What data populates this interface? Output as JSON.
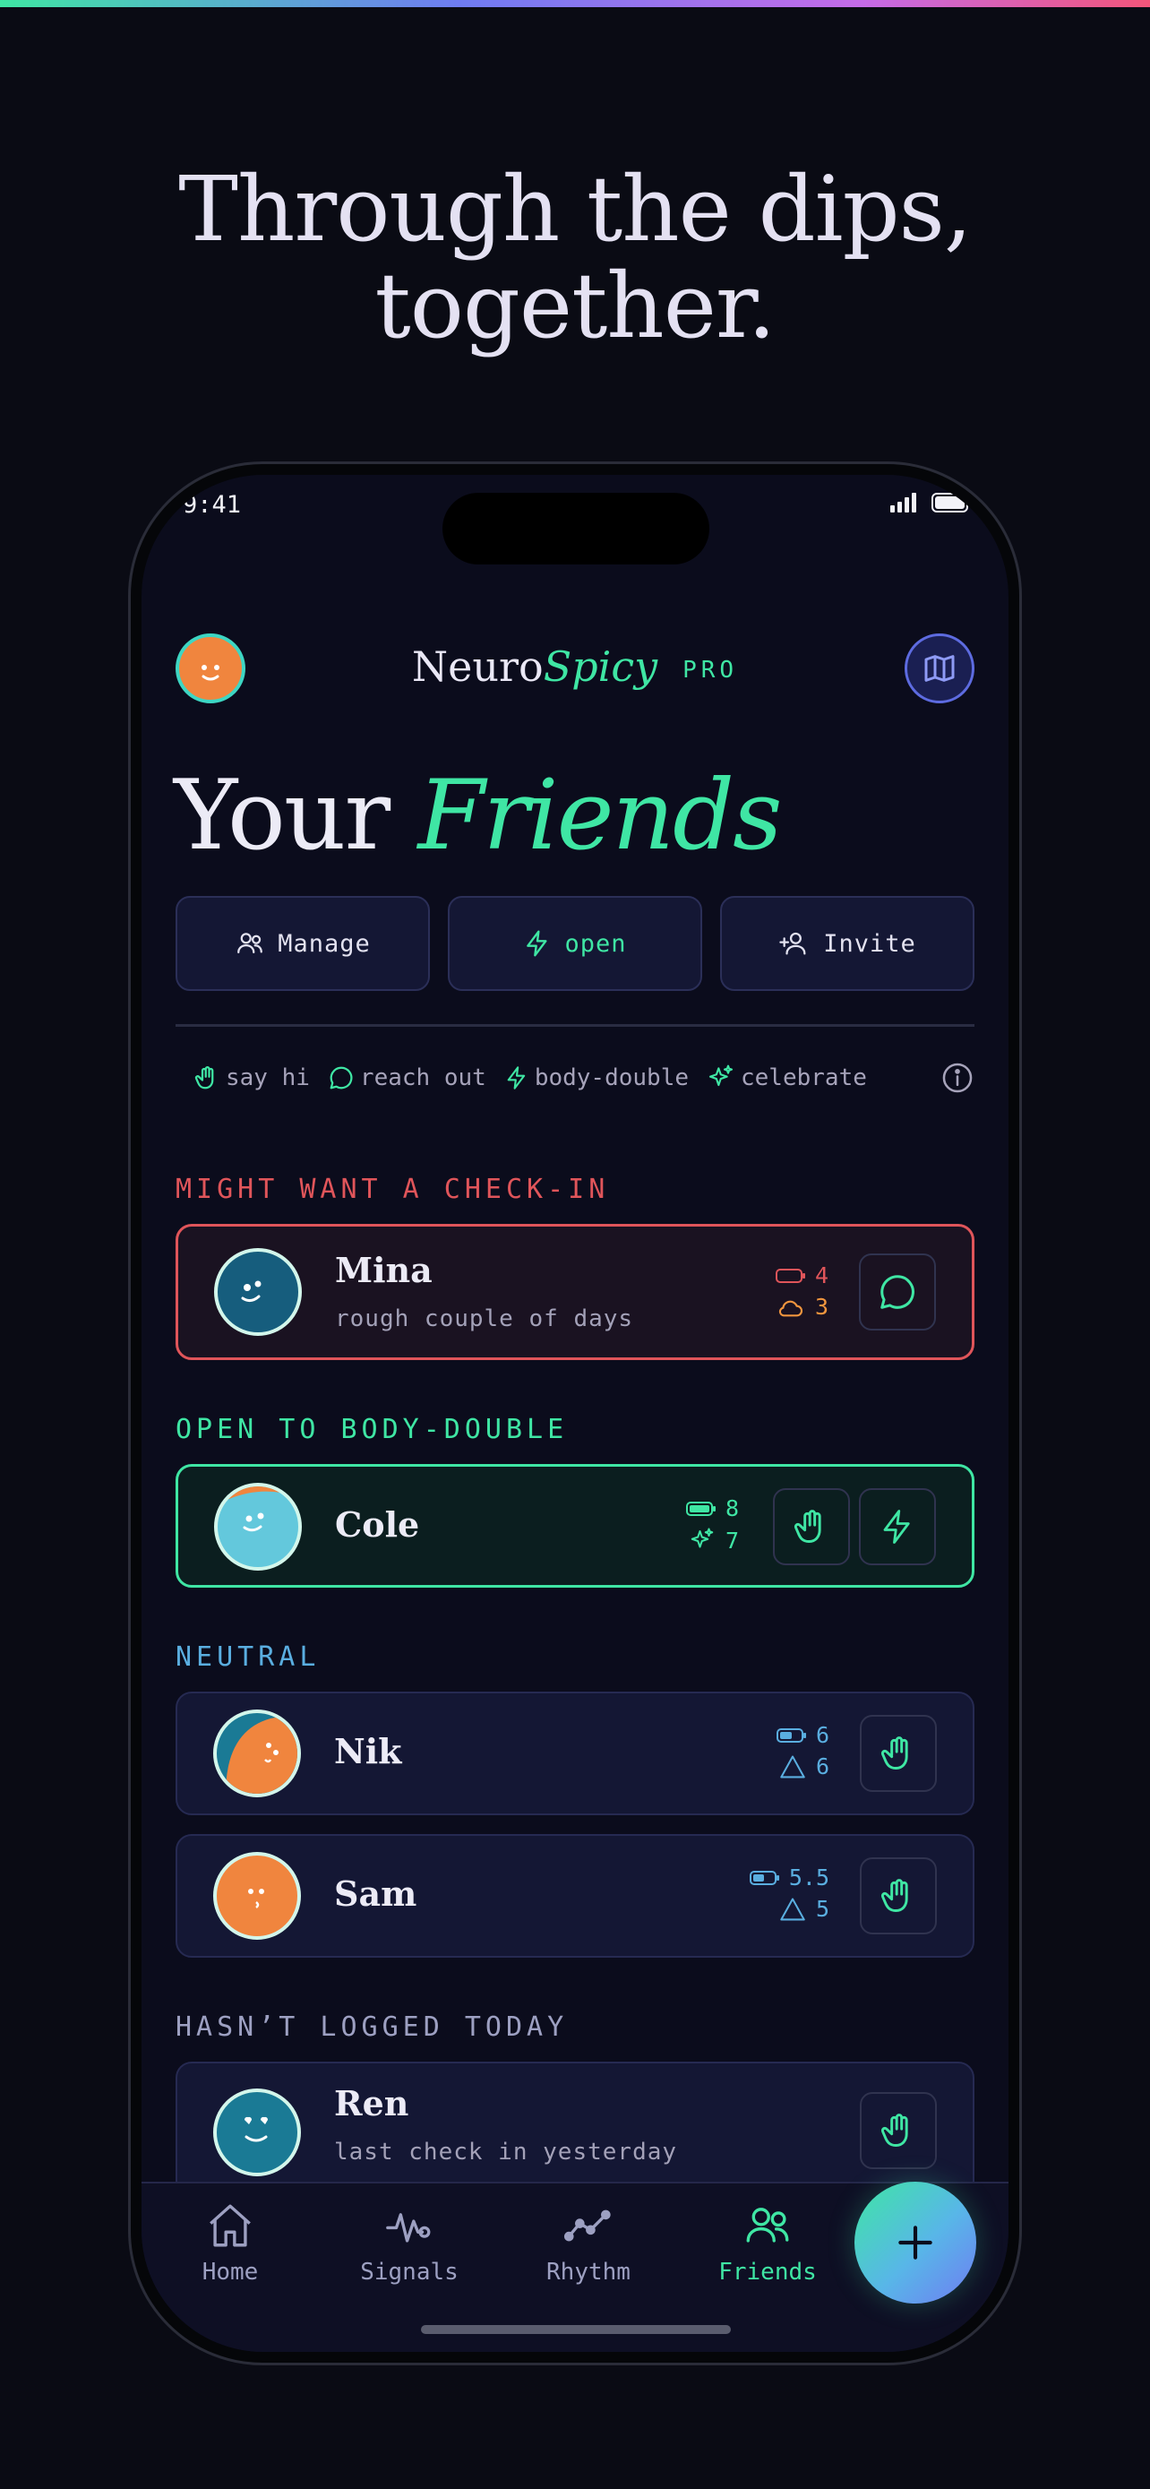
{
  "hero": {
    "line1": "Through the dips,",
    "line2": "together."
  },
  "status_bar": {
    "time": "9:41"
  },
  "header": {
    "brand_main": "Neuro",
    "brand_accent": "Spicy",
    "badge": "PRO"
  },
  "page_title": {
    "main": "Your",
    "accent": "Friends"
  },
  "actions": {
    "manage": "Manage",
    "open": "open",
    "invite": "Invite"
  },
  "legend": {
    "say_hi": "say hi",
    "reach_out": "reach out",
    "body_double": "body-double",
    "celebrate": "celebrate"
  },
  "sections": {
    "check_in": "MIGHT WANT A CHECK-IN",
    "body_double": "OPEN TO BODY-DOUBLE",
    "neutral": "NEUTRAL",
    "not_logged": "HASN’T LOGGED TODAY"
  },
  "friends": {
    "mina": {
      "name": "Mina",
      "note": "rough couple of days",
      "battery": "4",
      "mood": "3"
    },
    "cole": {
      "name": "Cole",
      "battery": "8",
      "sparkle": "7"
    },
    "nik": {
      "name": "Nik",
      "battery": "6",
      "tri": "6"
    },
    "sam": {
      "name": "Sam",
      "battery": "5.5",
      "tri": "5"
    },
    "ren": {
      "name": "Ren",
      "note": "last check in yesterday"
    }
  },
  "tabs": {
    "home": "Home",
    "signals": "Signals",
    "rhythm": "Rhythm",
    "friends": "Friends"
  },
  "colors": {
    "accent": "#3fe6a4",
    "alert": "#e0555a",
    "neutral": "#5aaee0",
    "bg": "#0b0c1c"
  }
}
